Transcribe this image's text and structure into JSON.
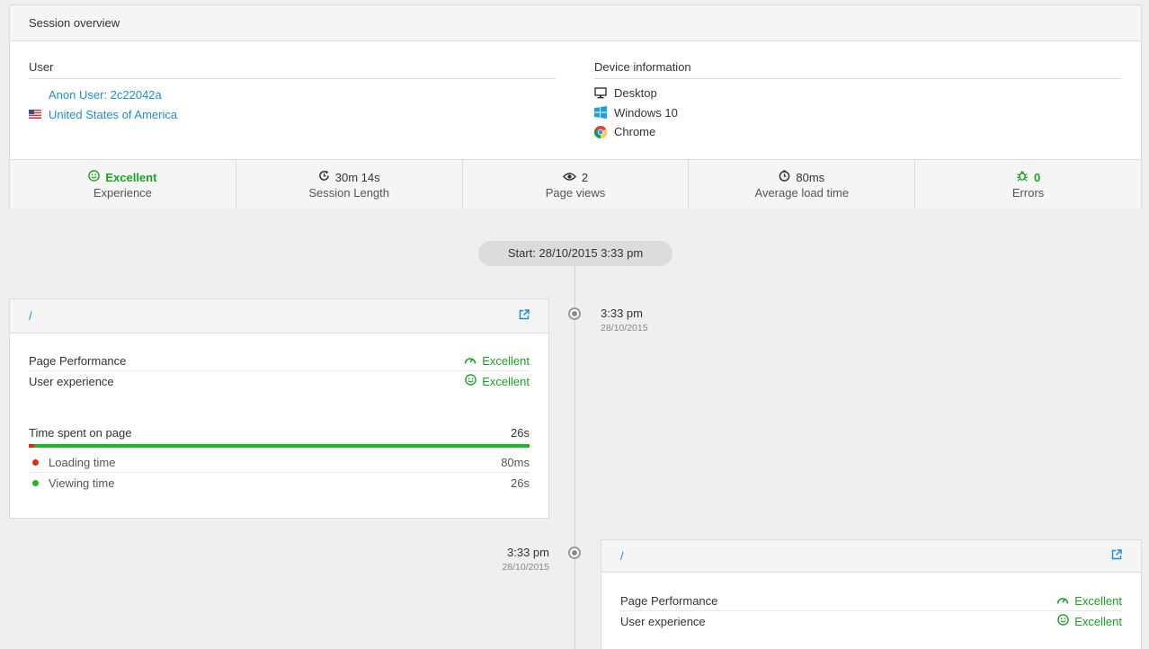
{
  "overview": {
    "title": "Session overview",
    "user": {
      "heading": "User",
      "name": "Anon User: 2c22042a",
      "country": "United States of America"
    },
    "device": {
      "heading": "Device information",
      "type": "Desktop",
      "os": "Windows 10",
      "browser": "Chrome"
    },
    "stats": [
      {
        "value": "Excellent",
        "label": "Experience",
        "icon": "smiley-icon"
      },
      {
        "value": "30m 14s",
        "label": "Session Length",
        "icon": "clock-refresh-icon"
      },
      {
        "value": "2",
        "label": "Page views",
        "icon": "eye-icon"
      },
      {
        "value": "80ms",
        "label": "Average load time",
        "icon": "stopwatch-icon"
      },
      {
        "value": "0",
        "label": "Errors",
        "icon": "bug-icon"
      }
    ]
  },
  "timeline": {
    "start_label": "Start: 28/10/2015 3:33 pm",
    "events": [
      {
        "time": "3:33 pm",
        "date": "28/10/2015",
        "path": "/",
        "page_performance_label": "Page Performance",
        "page_performance_value": "Excellent",
        "user_experience_label": "User experience",
        "user_experience_value": "Excellent",
        "time_spent_label": "Time spent on page",
        "time_spent_value": "26s",
        "loading_time_label": "Loading time",
        "loading_time_value": "80ms",
        "viewing_time_label": "Viewing time",
        "viewing_time_value": "26s",
        "loading_fraction": 0.003
      },
      {
        "time": "3:33 pm",
        "date": "28/10/2015",
        "path": "/",
        "page_performance_label": "Page Performance",
        "page_performance_value": "Excellent",
        "user_experience_label": "User experience",
        "user_experience_value": "Excellent"
      }
    ]
  },
  "colors": {
    "link": "#1a8fd9",
    "good": "#16a51f",
    "loading": "#e02a1a",
    "viewing": "#22b52a"
  }
}
